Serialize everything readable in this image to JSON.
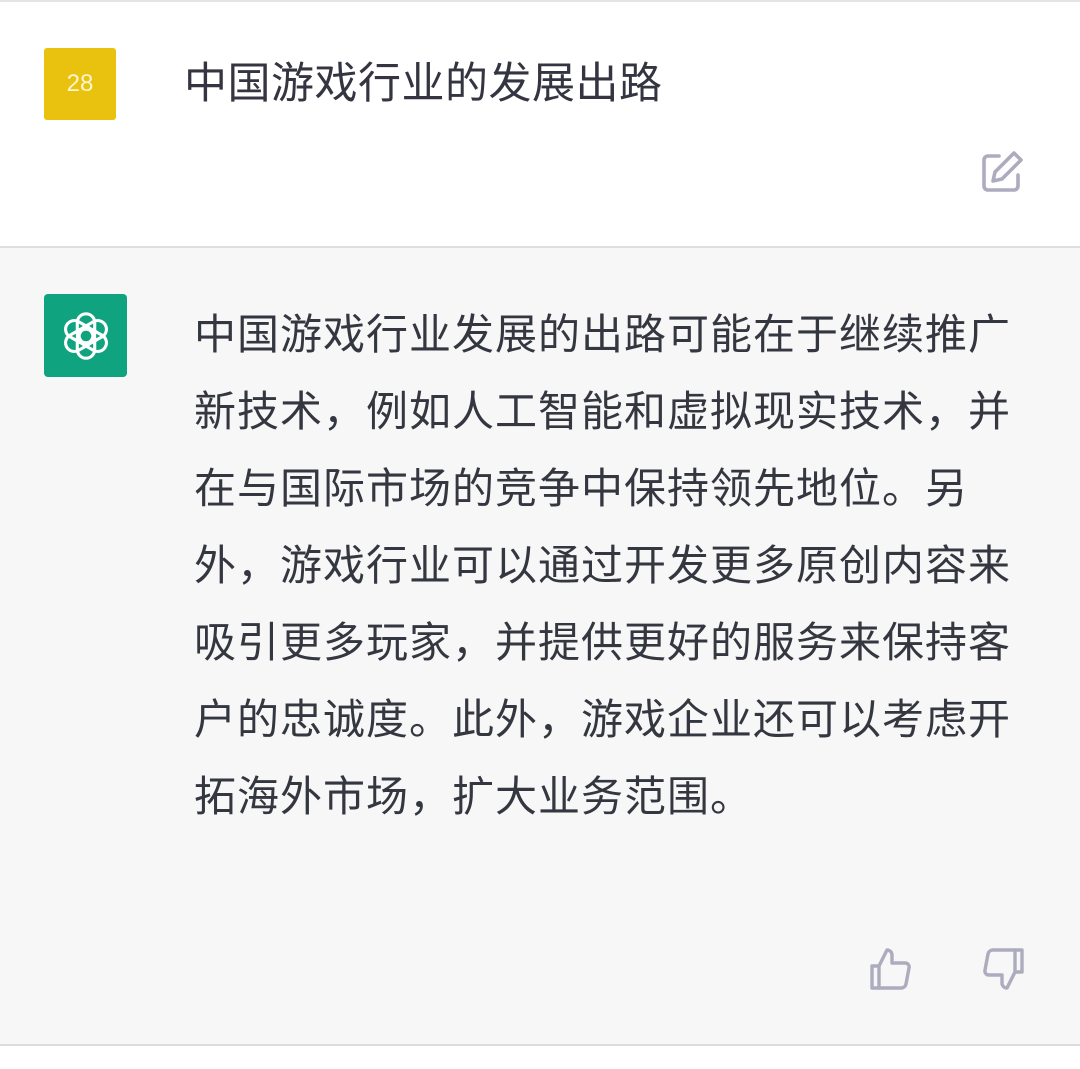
{
  "user_message": {
    "avatar_text": "28",
    "text": "中国游戏行业的发展出路",
    "avatar_color": "#e8c20f"
  },
  "assistant_message": {
    "text": "中国游戏行业发展的出路可能在于继续推广新技术，例如人工智能和虚拟现实技术，并在与国际市场的竞争中保持领先地位。另外，游戏行业可以通过开发更多原创内容来吸引更多玩家，并提供更好的服务来保持客户的忠诚度。此外，游戏企业还可以考虑开拓海外市场，扩大业务范围。",
    "avatar_color": "#10a37f",
    "avatar_icon": "openai-logo-icon"
  },
  "actions": {
    "edit_icon": "edit-icon",
    "thumb_up_icon": "thumbs-up-icon",
    "thumb_down_icon": "thumbs-down-icon"
  },
  "colors": {
    "user_bg": "#ffffff",
    "assistant_bg": "#f7f7f8",
    "text": "#353740",
    "icon": "#acacbe"
  }
}
